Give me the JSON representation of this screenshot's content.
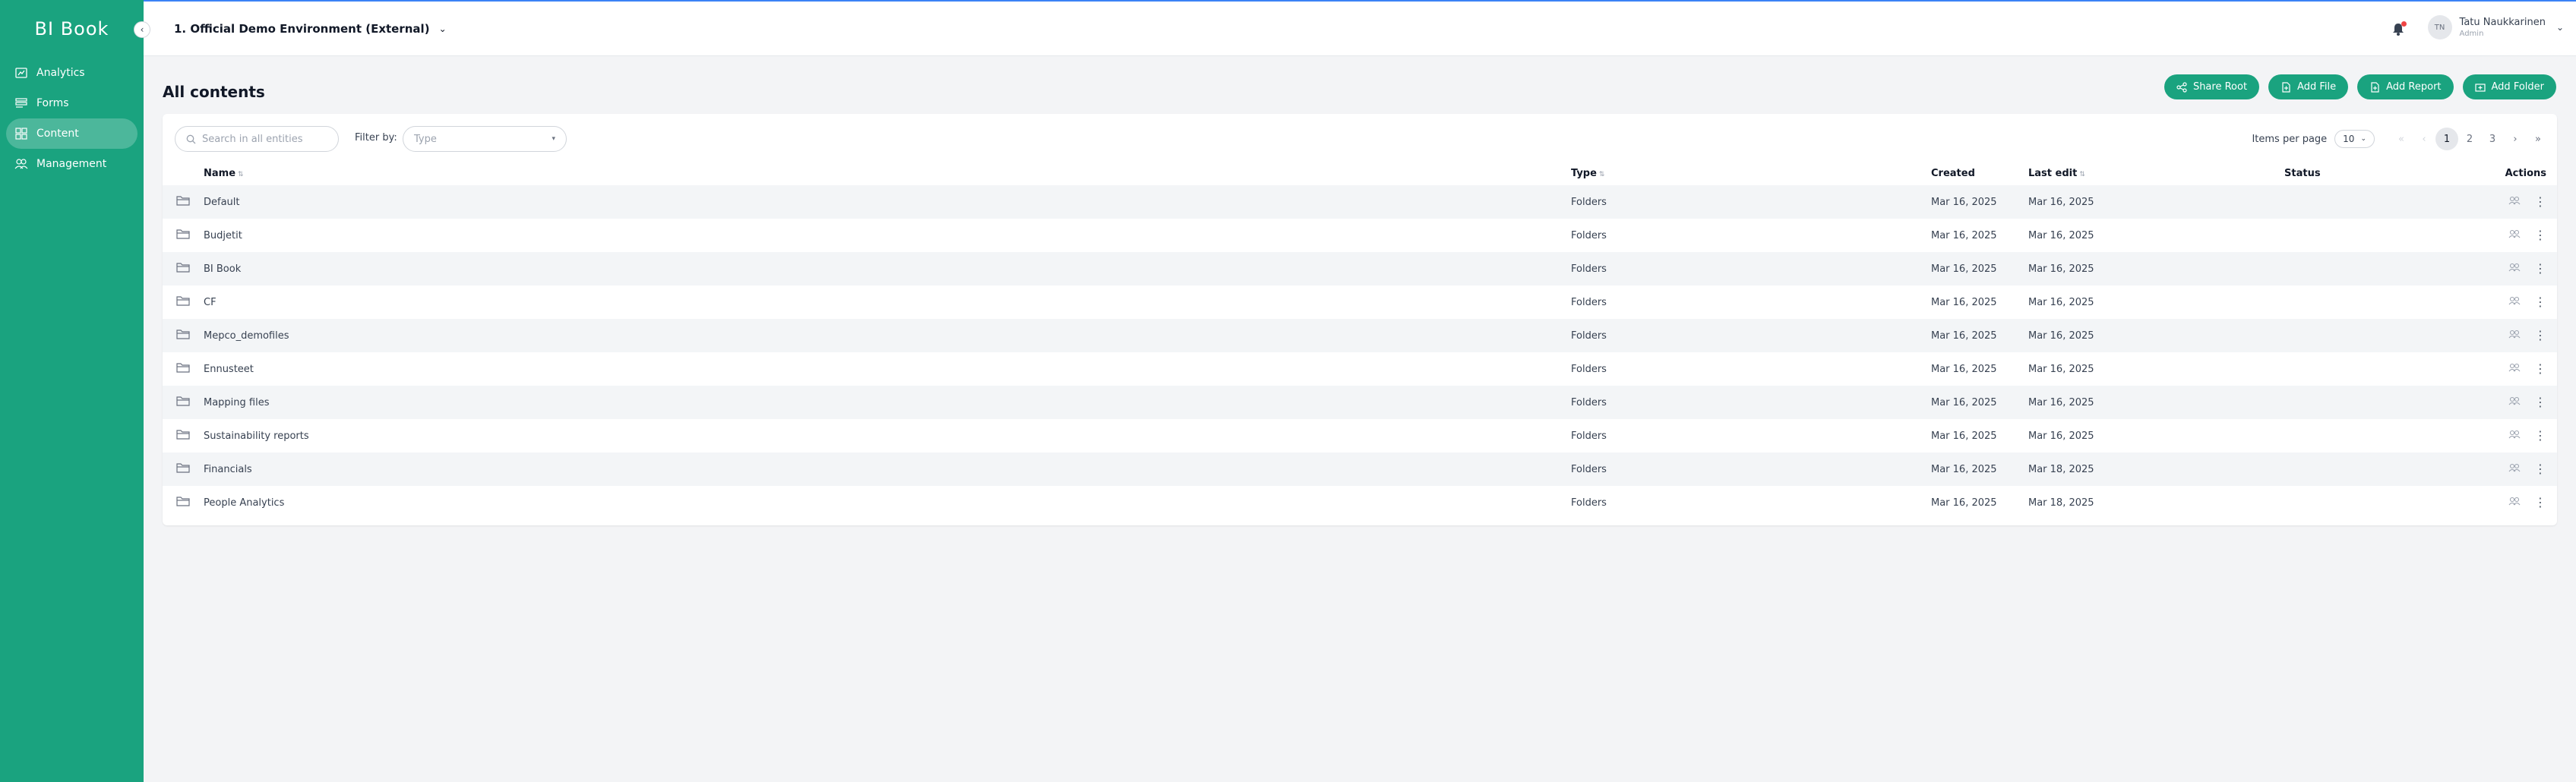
{
  "app": {
    "logo": "BI Book"
  },
  "sidebar": {
    "items": [
      {
        "label": "Analytics",
        "icon": "chart-icon",
        "active": false
      },
      {
        "label": "Forms",
        "icon": "form-icon",
        "active": false
      },
      {
        "label": "Content",
        "icon": "grid-icon",
        "active": true
      },
      {
        "label": "Management",
        "icon": "users-icon",
        "active": false
      }
    ]
  },
  "header": {
    "environment": "1. Official Demo Environment (External)",
    "user": {
      "initials": "TN",
      "name": "Tatu Naukkarinen",
      "role": "Admin"
    }
  },
  "main": {
    "title": "All contents",
    "buttons": {
      "share_root": "Share Root",
      "add_file": "Add File",
      "add_report": "Add Report",
      "add_folder": "Add Folder"
    },
    "search_placeholder": "Search in all entities",
    "filter_label": "Filter by:",
    "type_placeholder": "Type",
    "pager": {
      "items_per_page_label": "Items per page",
      "items_per_page": "10",
      "pages": [
        "1",
        "2",
        "3"
      ],
      "current": "1"
    },
    "columns": {
      "name": "Name",
      "type": "Type",
      "created": "Created",
      "last_edit": "Last edit",
      "status": "Status",
      "actions": "Actions"
    },
    "rows": [
      {
        "name": "Default",
        "type": "Folders",
        "created": "Mar 16, 2025",
        "last_edit": "Mar 16, 2025",
        "status": ""
      },
      {
        "name": "Budjetit",
        "type": "Folders",
        "created": "Mar 16, 2025",
        "last_edit": "Mar 16, 2025",
        "status": ""
      },
      {
        "name": "BI Book",
        "type": "Folders",
        "created": "Mar 16, 2025",
        "last_edit": "Mar 16, 2025",
        "status": ""
      },
      {
        "name": "CF",
        "type": "Folders",
        "created": "Mar 16, 2025",
        "last_edit": "Mar 16, 2025",
        "status": ""
      },
      {
        "name": "Mepco_demofiles",
        "type": "Folders",
        "created": "Mar 16, 2025",
        "last_edit": "Mar 16, 2025",
        "status": ""
      },
      {
        "name": "Ennusteet",
        "type": "Folders",
        "created": "Mar 16, 2025",
        "last_edit": "Mar 16, 2025",
        "status": ""
      },
      {
        "name": "Mapping files",
        "type": "Folders",
        "created": "Mar 16, 2025",
        "last_edit": "Mar 16, 2025",
        "status": ""
      },
      {
        "name": "Sustainability reports",
        "type": "Folders",
        "created": "Mar 16, 2025",
        "last_edit": "Mar 16, 2025",
        "status": ""
      },
      {
        "name": "Financials",
        "type": "Folders",
        "created": "Mar 16, 2025",
        "last_edit": "Mar 18, 2025",
        "status": ""
      },
      {
        "name": "People Analytics",
        "type": "Folders",
        "created": "Mar 16, 2025",
        "last_edit": "Mar 18, 2025",
        "status": ""
      }
    ]
  },
  "colors": {
    "brand": "#1aa37f",
    "notification": "#ef4444"
  }
}
